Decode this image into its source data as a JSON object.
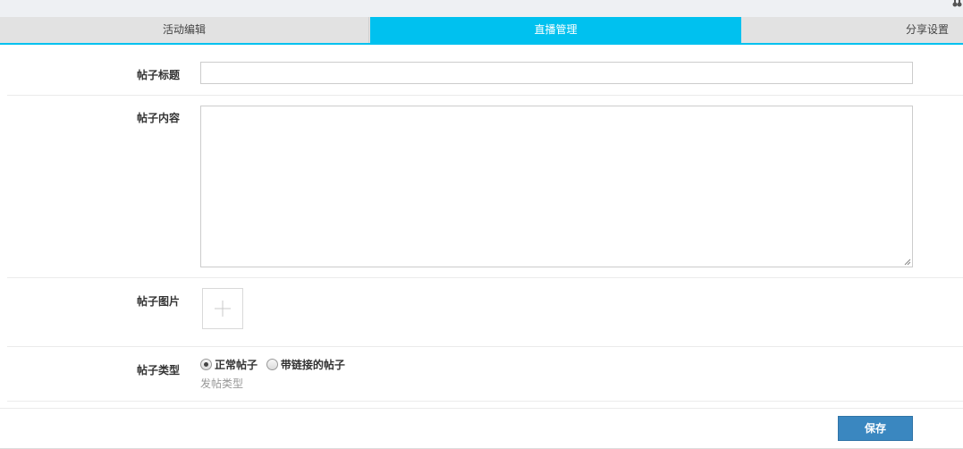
{
  "tabs": [
    {
      "label": "活动编辑",
      "active": false
    },
    {
      "label": "直播管理",
      "active": true
    },
    {
      "label": "分享设置",
      "active": false
    }
  ],
  "form": {
    "title": {
      "label": "帖子标题",
      "value": ""
    },
    "content": {
      "label": "帖子内容",
      "value": ""
    },
    "image": {
      "label": "帖子图片",
      "icon": "plus-icon"
    },
    "type": {
      "label": "帖子类型",
      "options": [
        {
          "label": "正常帖子",
          "checked": true
        },
        {
          "label": "带链接的帖子",
          "checked": false
        }
      ],
      "hint": "发帖类型"
    }
  },
  "footer": {
    "save_label": "保存"
  },
  "colors": {
    "accent": "#00c1ef",
    "button": "#3a87c0"
  },
  "icons": {
    "corner": "binoculars-icon"
  }
}
